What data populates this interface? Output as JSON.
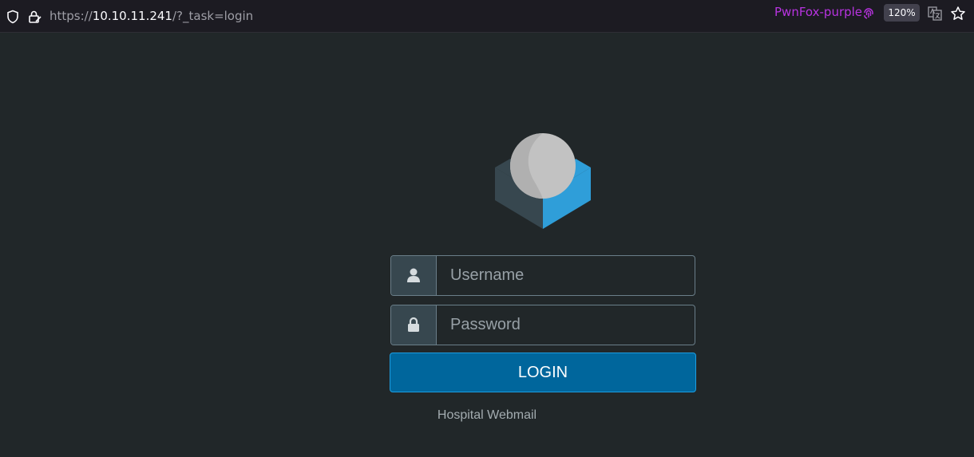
{
  "browser": {
    "url_prefix": "https://",
    "url_host": "10.10.11.241",
    "url_path": "/?_task=login",
    "container_label": "PwnFox-purple",
    "zoom": "120%",
    "colors": {
      "container": "#b833e1"
    }
  },
  "login": {
    "username_placeholder": "Username",
    "password_placeholder": "Password",
    "login_label": "LOGIN",
    "footer": "Hospital Webmail"
  },
  "icons": {
    "shield": "shield-icon",
    "lock": "lock-icon",
    "fingerprint": "fingerprint-icon",
    "translate": "translate-icon",
    "bookmark": "star-icon",
    "user": "user-icon",
    "password": "padlock-icon",
    "logo": "roundcube-logo"
  },
  "theme": {
    "background": "#212729",
    "button": "#00669c",
    "addon": "#37474f"
  }
}
